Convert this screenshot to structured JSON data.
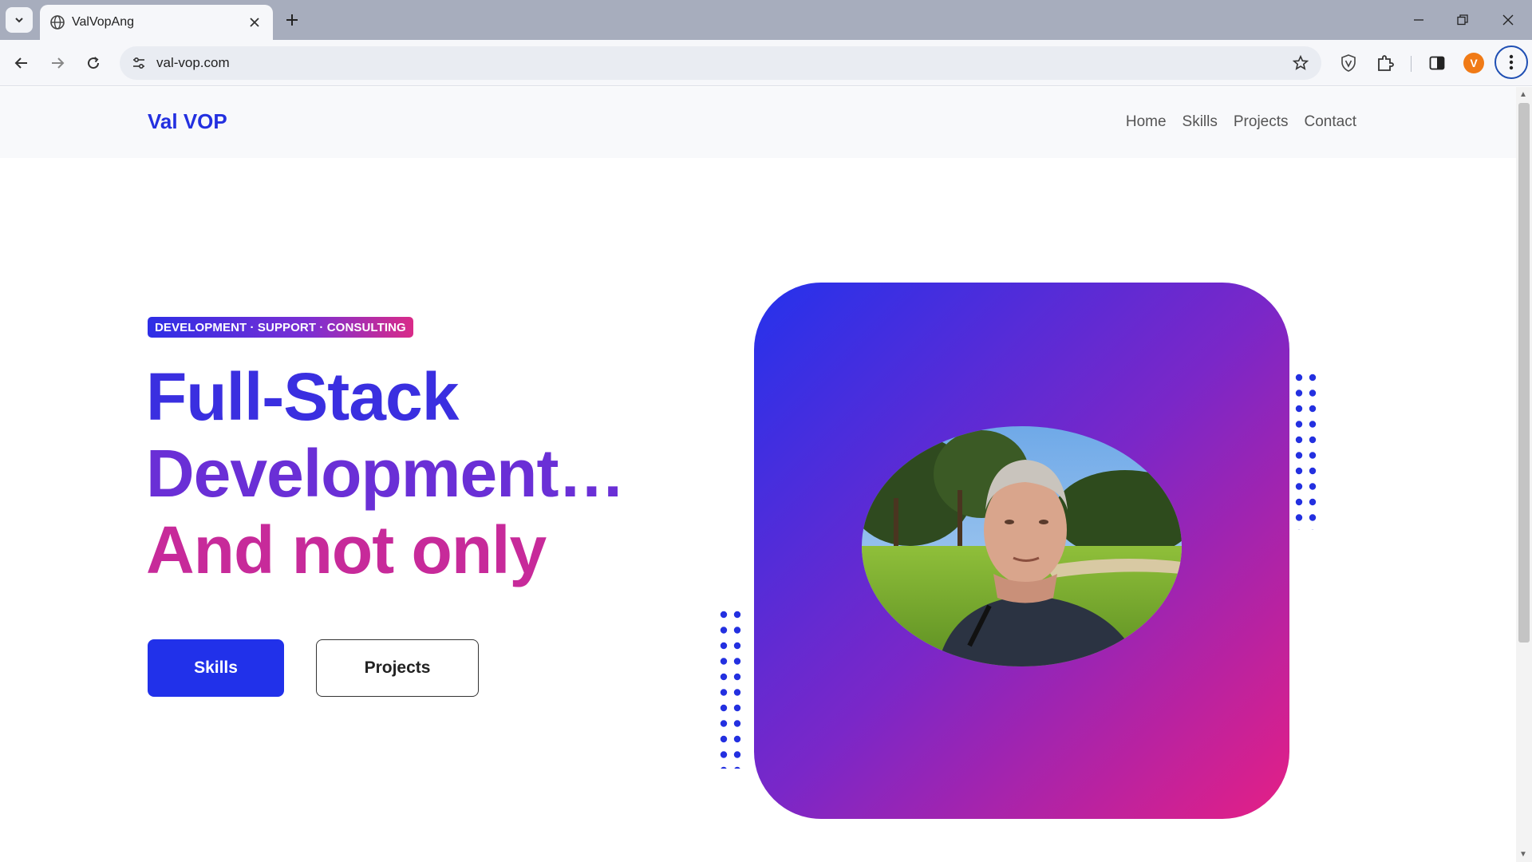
{
  "browser": {
    "tab_title": "ValVopAng",
    "url": "val-vop.com",
    "profile_initial": "V"
  },
  "site": {
    "logo": "Val VOP",
    "nav": [
      "Home",
      "Skills",
      "Projects",
      "Contact"
    ],
    "badge": "DEVELOPMENT · SUPPORT · CONSULTING",
    "headline": [
      "Full-Stack",
      "Development…",
      "And not only"
    ],
    "buttons": {
      "primary": "Skills",
      "secondary": "Projects"
    }
  },
  "colors": {
    "brand_blue": "#2131ea",
    "gradient_start": "#2532ec",
    "gradient_end": "#e51f85",
    "dots_blue": "#2330e0"
  }
}
